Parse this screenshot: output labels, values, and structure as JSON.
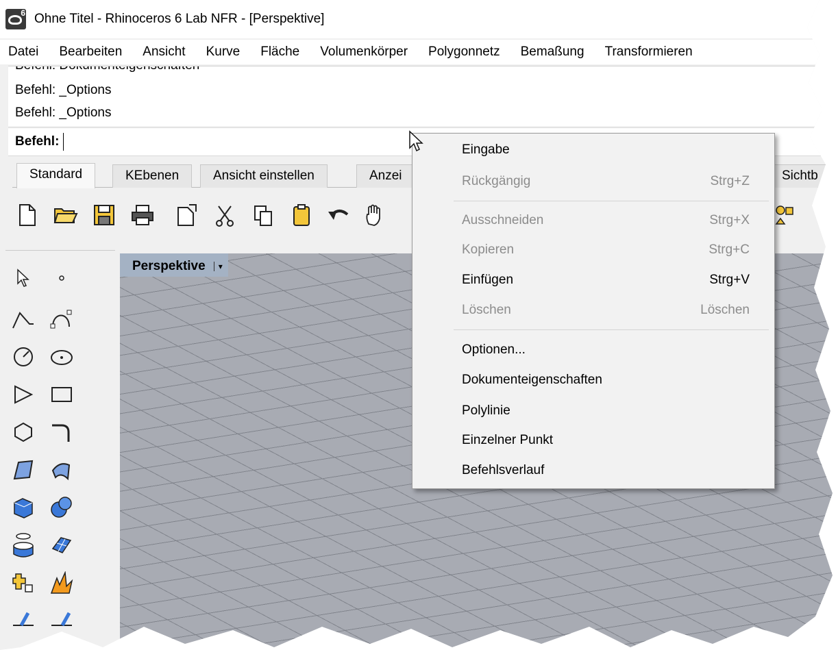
{
  "window": {
    "title": "Ohne Titel - Rhinoceros 6 Lab NFR - [Perspektive]",
    "icon": "rhino-app-icon"
  },
  "menubar": {
    "items": [
      "Datei",
      "Bearbeiten",
      "Ansicht",
      "Kurve",
      "Fläche",
      "Volumenkörper",
      "Polygonnetz",
      "Bemaßung",
      "Transformieren"
    ]
  },
  "command": {
    "history": [
      "Befehl: Dokumenteigenschaften",
      "Befehl: _Options",
      "Befehl: _Options"
    ],
    "prompt": "Befehl:",
    "value": ""
  },
  "toolbar_tabs": [
    "Standard",
    "KEbenen",
    "Ansicht einstellen",
    "Anzei",
    "Sichtb"
  ],
  "toolbar_icons": [
    "new-file-icon",
    "open-folder-icon",
    "save-icon",
    "print-icon",
    "import-icon",
    "cut-icon",
    "copy-icon",
    "paste-icon",
    "undo-icon",
    "pan-hand-icon",
    "groups-icon"
  ],
  "left_tools": [
    "select-arrow-icon",
    "point-icon",
    "polyline-icon",
    "curve-icon",
    "circle-icon",
    "ellipse-icon",
    "arc-icon",
    "rectangle-icon",
    "polygon-icon",
    "fillet-icon",
    "surface-points-icon",
    "surface-edge-icon",
    "box-icon",
    "sphere-icon",
    "cylinder-icon",
    "mesh-icon",
    "explode-icon",
    "boolean-icon",
    "dim-left-icon",
    "dim-right-icon"
  ],
  "viewport": {
    "label": "Perspektive",
    "dropdown": "▾"
  },
  "context_menu": {
    "items": [
      {
        "label": "Eingabe",
        "shortcut": "",
        "enabled": true
      },
      {
        "label": "Rückgängig",
        "shortcut": "Strg+Z",
        "enabled": false
      },
      {
        "label": "Ausschneiden",
        "shortcut": "Strg+X",
        "enabled": false
      },
      {
        "label": "Kopieren",
        "shortcut": "Strg+C",
        "enabled": false
      },
      {
        "label": "Einfügen",
        "shortcut": "Strg+V",
        "enabled": true
      },
      {
        "label": "Löschen",
        "shortcut": "Löschen",
        "enabled": false
      },
      {
        "label": "Optionen...",
        "shortcut": "",
        "enabled": true
      },
      {
        "label": "Dokumenteigenschaften",
        "shortcut": "",
        "enabled": true
      },
      {
        "label": "Polylinie",
        "shortcut": "",
        "enabled": true
      },
      {
        "label": "Einzelner Punkt",
        "shortcut": "",
        "enabled": true
      },
      {
        "label": "Befehlsverlauf",
        "shortcut": "",
        "enabled": true
      }
    ]
  },
  "colors": {
    "viewport_bg": "#a8abb3",
    "viewport_tab": "#a4b2c4",
    "menu_bg": "#f2f2f2",
    "disabled_text": "#8c8c8c"
  }
}
